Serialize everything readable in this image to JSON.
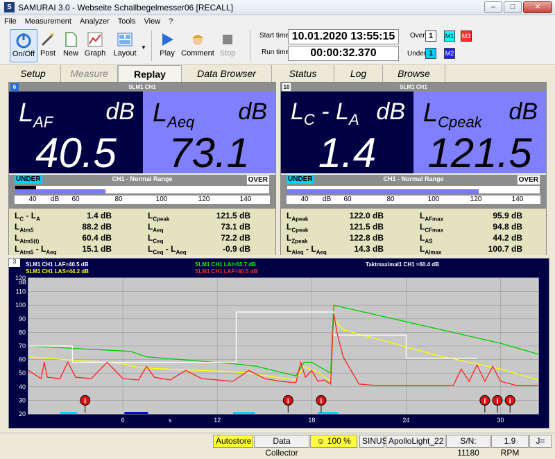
{
  "window": {
    "title": "SAMURAI 3.0 - Webseite Schallbegelmesser06 [RECALL]",
    "minimize": "–",
    "maximize": "□",
    "close": "✕"
  },
  "menu": [
    "File",
    "Measurement",
    "Analyzer",
    "Tools",
    "View",
    "?"
  ],
  "toolbar": {
    "onoff": "On/Off",
    "post": "Post",
    "new": "New",
    "graph": "Graph",
    "layout": "Layout",
    "play": "Play",
    "comment": "Comment",
    "stop": "Stop",
    "start_time_label": "Start time",
    "start_time": "10.01.2020 13:55:15",
    "run_time_label": "Run time",
    "run_time": "00:00:32.370",
    "over_label": "Over",
    "over_count": "1",
    "under_label": "Under",
    "under_count": "1",
    "m1": "M1",
    "m2": "M2",
    "m3": "M3"
  },
  "tabs": [
    "Setup",
    "Measure",
    "Replay",
    "Data Browser",
    "Status",
    "Log",
    "Browse"
  ],
  "panel_left": {
    "num": "6",
    "head": "SLM1 CH1",
    "big1": {
      "label": "L",
      "sub": "AF",
      "unit": "dB",
      "value": "40.5"
    },
    "big2": {
      "label": "L",
      "sub": "Aeq",
      "unit": "dB",
      "value": "73.1"
    },
    "under": "UNDER",
    "over": "OVER",
    "range": "CH1 - Normal Range",
    "ticks": [
      "40",
      "dB",
      "60",
      "80",
      "100",
      "120",
      "140"
    ],
    "rows_left": [
      {
        "label": "L",
        "sub": "C",
        "rest": " - L",
        "sub2": "A",
        "value": "1.4 dB"
      },
      {
        "label": "L",
        "sub": "Atm5",
        "rest": "",
        "sub2": "",
        "value": "88.2 dB"
      },
      {
        "label": "L",
        "sub": "Atm5(t)",
        "rest": "",
        "sub2": "",
        "value": "60.4 dB"
      },
      {
        "label": "L",
        "sub": "Atm5",
        "rest": " - L",
        "sub2": "Aeq",
        "value": "15.1 dB"
      }
    ],
    "rows_right": [
      {
        "label": "L",
        "sub": "Cpeak",
        "rest": "",
        "sub2": "",
        "value": "121.5 dB"
      },
      {
        "label": "L",
        "sub": "Aeq",
        "rest": "",
        "sub2": "",
        "value": "73.1 dB"
      },
      {
        "label": "L",
        "sub": "Ceq",
        "rest": "",
        "sub2": "",
        "value": "72.2 dB"
      },
      {
        "label": "L",
        "sub": "Ceq",
        "rest": " - L",
        "sub2": "Aeq",
        "value": "-0.9 dB"
      }
    ]
  },
  "panel_right": {
    "num": "10",
    "head": "SLM1 CH1",
    "big1": {
      "label": "L",
      "sub": "C",
      "mid": " - L",
      "sub2": "A",
      "unit": "dB",
      "value": "1.4"
    },
    "big2": {
      "label": "L",
      "sub": "Cpeak",
      "unit": "dB",
      "value": "121.5"
    },
    "under": "UNDER",
    "over": "OVER",
    "range": "CH1 - Normal Range",
    "ticks": [
      "40",
      "dB",
      "60",
      "80",
      "100",
      "120",
      "140"
    ],
    "rows_left": [
      {
        "label": "L",
        "sub": "Apeak",
        "rest": "",
        "sub2": "",
        "value": "122.0 dB"
      },
      {
        "label": "L",
        "sub": "Cpeak",
        "rest": "",
        "sub2": "",
        "value": "121.5 dB"
      },
      {
        "label": "L",
        "sub": "Zpeak",
        "rest": "",
        "sub2": "",
        "value": "122.8 dB"
      },
      {
        "label": "L",
        "sub": "Aleq",
        "rest": " - L",
        "sub2": "Aeq",
        "value": "14.3 dB"
      }
    ],
    "rows_right": [
      {
        "label": "L",
        "sub": "AFmax",
        "rest": "",
        "sub2": "",
        "value": "95.9 dB"
      },
      {
        "label": "L",
        "sub": "CFmax",
        "rest": "",
        "sub2": "",
        "value": "94.8 dB"
      },
      {
        "label": "L",
        "sub": "AS",
        "rest": "",
        "sub2": "",
        "value": "44.2 dB"
      },
      {
        "label": "L",
        "sub": "AImax",
        "rest": "",
        "sub2": "",
        "value": "100.7 dB"
      }
    ]
  },
  "graph_panel": {
    "num": "3",
    "legend": [
      {
        "text": "SLM1 CH1 LAF=40.5 dB",
        "color": "#ffffff"
      },
      {
        "text": "SLM1 CH1 LAS=44.2 dB",
        "color": "#ffff00"
      },
      {
        "text": "SLM1 CH1 LAI=63.7 dB",
        "color": "#00ff00"
      },
      {
        "text": "SLM1 CH1 LAF=40.5 dB",
        "color": "#ff3030"
      },
      {
        "text": "Taktmaximal1 CH1 =60.4 dB",
        "color": "#ffffff"
      }
    ]
  },
  "chart_data": {
    "type": "line",
    "ylabel": "dB",
    "xunit": "s",
    "ylim": [
      20,
      120
    ],
    "xlim": [
      0,
      32.4
    ],
    "yticks": [
      20,
      30,
      40,
      50,
      60,
      70,
      80,
      90,
      100,
      110,
      120
    ],
    "xticks": [
      6,
      12,
      18,
      24,
      30
    ],
    "series": [
      {
        "name": "LAI",
        "color": "#00cc00",
        "x": [
          0,
          6.5,
          7.5,
          13,
          14.5,
          17,
          17.5,
          18,
          19.2,
          19.4,
          30,
          32.4
        ],
        "y": [
          70,
          66,
          62,
          57,
          55,
          48,
          58,
          58,
          50,
          100,
          72,
          64
        ]
      },
      {
        "name": "LAS",
        "color": "#ffff00",
        "x": [
          0,
          6,
          7,
          13,
          14,
          17,
          17.5,
          18.5,
          19.2,
          19.4,
          20,
          26,
          30,
          32.4
        ],
        "y": [
          62,
          57,
          54,
          51,
          50,
          45,
          55,
          50,
          44,
          90,
          82,
          63,
          53,
          45
        ]
      },
      {
        "name": "Taktmaximal",
        "color": "#ffffff",
        "x": [
          0,
          2.8,
          2.8,
          13.2,
          13.2,
          17,
          17,
          19.4,
          19.4,
          24,
          24,
          28.5
        ],
        "y": [
          70,
          70,
          58,
          58,
          95,
          95,
          95,
          95,
          78,
          78,
          61,
          61
        ]
      },
      {
        "name": "LAF",
        "color": "#ff2020",
        "x": [
          0,
          0.8,
          1,
          1.2,
          2,
          2.5,
          3,
          4,
          5,
          6,
          7,
          7.5,
          8,
          9,
          10,
          11,
          12,
          13,
          14,
          15,
          16,
          17,
          17.3,
          17.6,
          18,
          18.4,
          18.8,
          19.2,
          19.4,
          19.6,
          20,
          21,
          22,
          23,
          24,
          25,
          26,
          27,
          27.5,
          28,
          28.5,
          29,
          29.5,
          30,
          31,
          32,
          32.4
        ],
        "y": [
          52,
          46,
          58,
          47,
          46,
          58,
          47,
          46,
          58,
          46,
          45,
          55,
          47,
          45,
          52,
          46,
          45,
          44,
          52,
          46,
          44,
          43,
          58,
          47,
          52,
          44,
          45,
          42,
          94,
          80,
          62,
          42,
          41,
          41,
          41,
          41,
          41,
          41,
          53,
          44,
          56,
          44,
          55,
          44,
          41,
          41,
          41
        ]
      }
    ],
    "markers": {
      "label": "I",
      "x": [
        3.6,
        16.5,
        18.6,
        29.0,
        29.8,
        30.6
      ]
    },
    "bars": [
      {
        "x0": 2,
        "x1": 3.1,
        "color": "#00d0ff"
      },
      {
        "x0": 6.1,
        "x1": 7.6,
        "color": "#0000cc"
      },
      {
        "x0": 13,
        "x1": 14.4,
        "color": "#00d0ff"
      },
      {
        "x0": 18.4,
        "x1": 19.7,
        "color": "#00d0ff"
      }
    ],
    "label_color": "#ffffff",
    "bg": "#c8c8c8"
  },
  "status": {
    "autostore": "Autostore",
    "collector": "Data Collector",
    "battery": "100 %",
    "sinus": "SINUS",
    "device": "ApolloLight_22",
    "serial": "S/N: 11180",
    "rpm": "1.9 RPM",
    "last": "J="
  }
}
